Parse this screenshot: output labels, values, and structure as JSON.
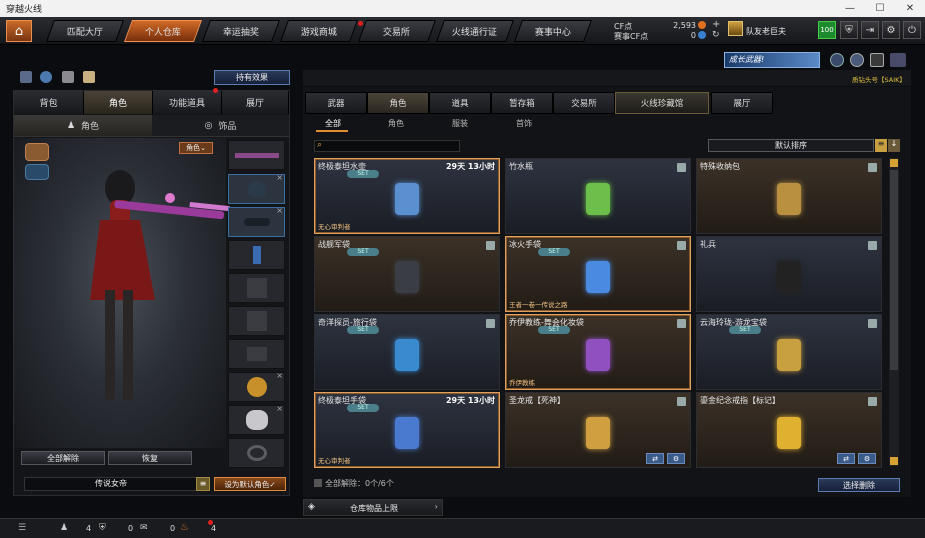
{
  "window": {
    "title": "穿越火线",
    "min": "—",
    "max": "☐",
    "close": "✕"
  },
  "nav": {
    "tabs": [
      "匹配大厅",
      "个人仓库",
      "幸运抽奖",
      "游戏商城",
      "交易所",
      "火线通行证",
      "赛事中心"
    ],
    "cf_label": "CF点",
    "cf_value": "2,593",
    "cfc_label": "赛事CF点",
    "cfc_value": "0",
    "rank_name": "队友老巨夫",
    "score": "100"
  },
  "left": {
    "effects_button": "持有效果",
    "tabs": [
      "背包",
      "角色",
      "功能道具",
      "展厅"
    ],
    "subtabs": [
      "角色",
      "饰品"
    ],
    "role_filter": "角色",
    "unequip_all": "全部解除",
    "restore": "恢复",
    "character_name": "传说女帝",
    "set_default": "设为默认角色"
  },
  "right": {
    "banner": "成长武器!",
    "banner_caption": "质钻头号【SAIK】",
    "tabs": [
      "武器",
      "角色",
      "道具",
      "暂存箱",
      "交易所",
      "火线珍藏馆",
      "展厅"
    ],
    "filters": [
      "全部",
      "角色",
      "服装",
      "首饰"
    ],
    "sort": "默认排序",
    "items": [
      {
        "name": "终极泰坦水壶",
        "time": "29天 13小时",
        "set": "SET",
        "foot": "无心审判者",
        "color": "#5a8fd0"
      },
      {
        "name": "竹水瓶",
        "time": "",
        "set": "",
        "foot": "",
        "color": "#6bbf4a"
      },
      {
        "name": "特殊收纳包",
        "time": "",
        "set": "",
        "foot": "",
        "color": "#b89040"
      },
      {
        "name": "战舰军袋",
        "time": "",
        "set": "SET",
        "foot": "",
        "color": "#3a3d44"
      },
      {
        "name": "冰火手袋",
        "time": "",
        "set": "SET",
        "foot": "王者一卷一传说之路",
        "color": "#4a8ae0"
      },
      {
        "name": "礼兵",
        "time": "",
        "set": "",
        "foot": "",
        "color": "#222"
      },
      {
        "name": "奇洋探员-旅行袋",
        "time": "",
        "set": "SET",
        "foot": "",
        "color": "#3a8ad0"
      },
      {
        "name": "乔伊教练-舞会化妆袋",
        "time": "",
        "set": "SET",
        "foot": "乔伊教练",
        "color": "#9050c0"
      },
      {
        "name": "云海玲珑-游龙宝袋",
        "time": "",
        "set": "SET",
        "foot": "",
        "color": "#c8a040"
      },
      {
        "name": "终极泰坦手袋",
        "time": "29天 13小时",
        "set": "SET",
        "foot": "无心审判者",
        "color": "#4a7ad0"
      },
      {
        "name": "圣龙戒【死神】",
        "time": "",
        "set": "",
        "foot": "",
        "color": "#d0a040"
      },
      {
        "name": "鎏金纪念戒指【标记】",
        "time": "",
        "set": "",
        "foot": "",
        "color": "#e0b030"
      }
    ],
    "unequip_info": "全部解除：0个/6个",
    "select_delete": "选择删除",
    "capacity": "仓库物品上限"
  },
  "status": {
    "c1": "4",
    "c2": "0",
    "c3": "0",
    "c4": "4"
  }
}
